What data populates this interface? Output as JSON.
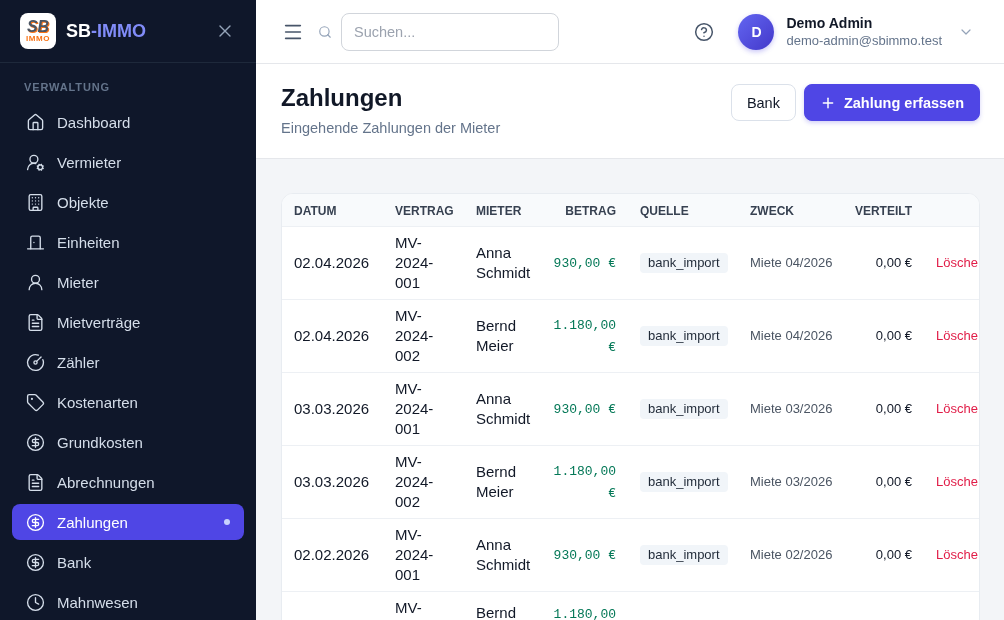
{
  "sidebar": {
    "logo": {
      "line_1": "SB",
      "line_2": "IMMO"
    },
    "brand": {
      "start": "SB",
      "end": "-IMMO"
    },
    "section": "VERWALTUNG",
    "items": [
      {
        "label": "Dashboard",
        "selected": false
      },
      {
        "label": "Vermieter",
        "selected": false
      },
      {
        "label": "Objekte",
        "selected": false
      },
      {
        "label": "Einheiten",
        "selected": false
      },
      {
        "label": "Mieter",
        "selected": false
      },
      {
        "label": "Mietverträge",
        "selected": false
      },
      {
        "label": "Zähler",
        "selected": false
      },
      {
        "label": "Kostenarten",
        "selected": false
      },
      {
        "label": "Grundkosten",
        "selected": false
      },
      {
        "label": "Abrechnungen",
        "selected": false
      },
      {
        "label": "Zahlungen",
        "selected": true
      },
      {
        "label": "Bank",
        "selected": false
      },
      {
        "label": "Mahnwesen",
        "selected": false
      }
    ]
  },
  "topbar": {
    "search": {
      "placeholder": "Suchen..."
    },
    "user": {
      "initial": "D",
      "name": "Demo Admin",
      "email": "demo-admin@sbimmo.test"
    }
  },
  "page": {
    "title": "Zahlungen",
    "subtitle": "Eingehende Zahlungen der Mieter",
    "buttons": [
      {
        "label": "Bank",
        "kind": "secondary"
      },
      {
        "label": "Zahlung erfassen",
        "kind": "primary"
      }
    ]
  },
  "table": {
    "columns": [
      "DATUM",
      "VERTRAG",
      "MIETER",
      "BETRAG",
      "QUELLE",
      "ZWECK",
      "VERTEILT"
    ],
    "rows": [
      {
        "date": "02.04.2026",
        "contract": "MV-2024-001",
        "tenant": "Anna Schmidt",
        "amount": "930,00 €",
        "source": "bank_import",
        "purpose": "Miete 04/2026",
        "distributed": "0,00 €",
        "action": "Lösche"
      },
      {
        "date": "02.04.2026",
        "contract": "MV-2024-002",
        "tenant": "Bernd Meier",
        "amount": "1.180,00 €",
        "source": "bank_import",
        "purpose": "Miete 04/2026",
        "distributed": "0,00 €",
        "action": "Lösche"
      },
      {
        "date": "03.03.2026",
        "contract": "MV-2024-001",
        "tenant": "Anna Schmidt",
        "amount": "930,00 €",
        "source": "bank_import",
        "purpose": "Miete 03/2026",
        "distributed": "0,00 €",
        "action": "Lösche"
      },
      {
        "date": "03.03.2026",
        "contract": "MV-2024-002",
        "tenant": "Bernd Meier",
        "amount": "1.180,00 €",
        "source": "bank_import",
        "purpose": "Miete 03/2026",
        "distributed": "0,00 €",
        "action": "Lösche"
      },
      {
        "date": "02.02.2026",
        "contract": "MV-2024-001",
        "tenant": "Anna Schmidt",
        "amount": "930,00 €",
        "source": "bank_import",
        "purpose": "Miete 02/2026",
        "distributed": "0,00 €",
        "action": "Lösche"
      },
      {
        "contract": "MV-",
        "tenant": "Bernd",
        "amount": "1.180,00"
      }
    ]
  }
}
